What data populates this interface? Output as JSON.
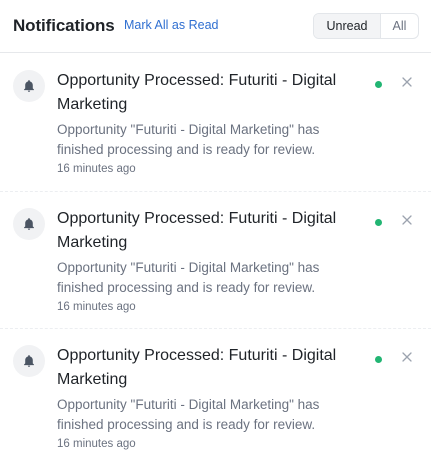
{
  "header": {
    "title": "Notifications",
    "mark_all_label": "Mark All as Read",
    "filter": {
      "unread_label": "Unread",
      "all_label": "All",
      "selected": "Unread"
    }
  },
  "colors": {
    "accent": "#2f6fd1",
    "unread_dot": "#22b573"
  },
  "notifications": [
    {
      "icon": "bell-icon",
      "title": "Opportunity Processed: Futuriti - Digital Marketing",
      "description": "Opportunity \"Futuriti - Digital Marketing\" has finished processing and is ready for review.",
      "time": "16 minutes ago",
      "unread": true
    },
    {
      "icon": "bell-icon",
      "title": "Opportunity Processed: Futuriti - Digital Marketing",
      "description": "Opportunity \"Futuriti - Digital Marketing\" has finished processing and is ready for review.",
      "time": "16 minutes ago",
      "unread": true
    },
    {
      "icon": "bell-icon",
      "title": "Opportunity Processed: Futuriti - Digital Marketing",
      "description": "Opportunity \"Futuriti - Digital Marketing\" has finished processing and is ready for review.",
      "time": "16 minutes ago",
      "unread": true
    }
  ]
}
